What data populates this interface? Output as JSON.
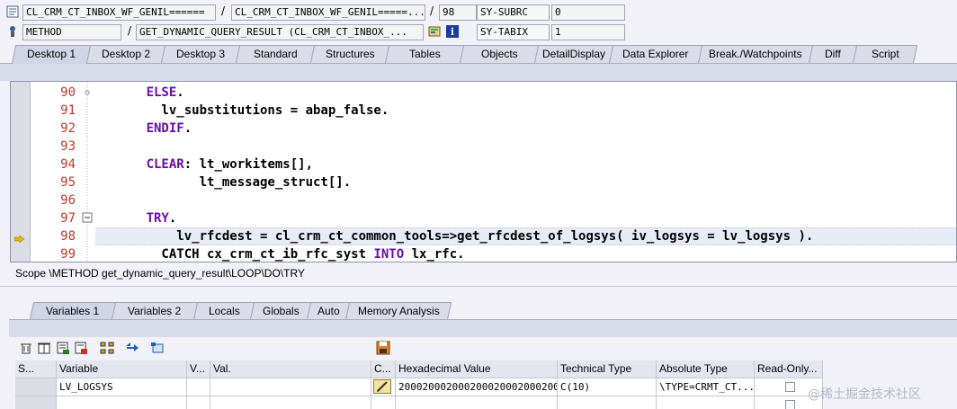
{
  "header": {
    "row1": {
      "program": "CL_CRM_CT_INBOX_WF_GENIL======",
      "include": "CL_CRM_CT_INBOX_WF_GENIL=====...",
      "line": "98",
      "sysfield_label": "SY-SUBRC",
      "sysfield_value": "0"
    },
    "row2": {
      "event_type": "METHOD",
      "event_name": "GET_DYNAMIC_QUERY_RESULT (CL_CRM_CT_INBOX_...",
      "sysfield_label": "SY-TABIX",
      "sysfield_value": "1"
    },
    "separator": "/"
  },
  "main_tabs": [
    "Desktop 1",
    "Desktop 2",
    "Desktop 3",
    "Standard",
    "Structures",
    "Tables",
    "Objects",
    "DetailDisplay",
    "Data Explorer",
    "Break./Watchpoints",
    "Diff",
    "Script"
  ],
  "main_tabs_active": "Desktop 1",
  "code": [
    {
      "no": "90",
      "segs": [
        {
          "t": "      "
        },
        {
          "t": "ELSE",
          "c": "kw"
        },
        {
          "t": "."
        }
      ]
    },
    {
      "no": "91",
      "segs": [
        {
          "t": "        lv_substitutions = abap_false."
        }
      ]
    },
    {
      "no": "92",
      "segs": [
        {
          "t": "      "
        },
        {
          "t": "ENDIF",
          "c": "kw"
        },
        {
          "t": "."
        }
      ]
    },
    {
      "no": "93",
      "segs": [
        {
          "t": ""
        }
      ]
    },
    {
      "no": "94",
      "segs": [
        {
          "t": "      "
        },
        {
          "t": "CLEAR",
          "c": "kw"
        },
        {
          "t": ": lt_workitems[],"
        }
      ]
    },
    {
      "no": "95",
      "segs": [
        {
          "t": "             lt_message_struct[]."
        }
      ]
    },
    {
      "no": "96",
      "segs": [
        {
          "t": ""
        }
      ]
    },
    {
      "no": "97",
      "segs": [
        {
          "t": "      "
        },
        {
          "t": "TRY",
          "c": "kw"
        },
        {
          "t": "."
        }
      ]
    },
    {
      "no": "98",
      "segs": [
        {
          "t": "          lv_rfcdest = cl_crm_ct_common_tools=>get_rfcdest_of_logsys( iv_logsys = lv_logsys )."
        }
      ]
    },
    {
      "no": "99",
      "segs": [
        {
          "t": "        CATCH cx_crm_ct_ib_rfc_syst "
        },
        {
          "t": "INTO",
          "c": "kw"
        },
        {
          "t": " lx_rfc."
        }
      ]
    }
  ],
  "scope": "Scope \\METHOD get_dynamic_query_result\\LOOP\\DO\\TRY",
  "variable_tabs": [
    "Variables 1",
    "Variables 2",
    "Locals",
    "Globals",
    "Auto",
    "Memory Analysis"
  ],
  "variable_tabs_active": "Variables 1",
  "toolbar_icons": [
    "delete-icon",
    "delete-all-icon",
    "save-variables-icon",
    "load-variables-icon",
    "hierarchy-icon",
    "transfer-icon",
    "details-icon",
    "save-icon"
  ],
  "table": {
    "columns": [
      "S...",
      "Variable",
      "V...",
      "Val.",
      "C...",
      "Hexadecimal Value",
      "Technical Type",
      "Absolute Type",
      "Read-Only..."
    ],
    "rows": [
      {
        "variable": "LV_LOGSYS",
        "val": "",
        "hex": "2000200020002000200020002000...",
        "tech_type": "C(10)",
        "abs_type": "\\TYPE=CRMT_CT..."
      },
      {
        "variable": "",
        "val": "",
        "hex": "",
        "tech_type": "",
        "abs_type": ""
      }
    ]
  },
  "watermark": "@稀土掘金技术社区",
  "colors": {
    "keyword": "#6a0dad",
    "line_number": "#c0392b",
    "tab_bg": "#dcdce8",
    "current_line": "#e6ecf6"
  }
}
